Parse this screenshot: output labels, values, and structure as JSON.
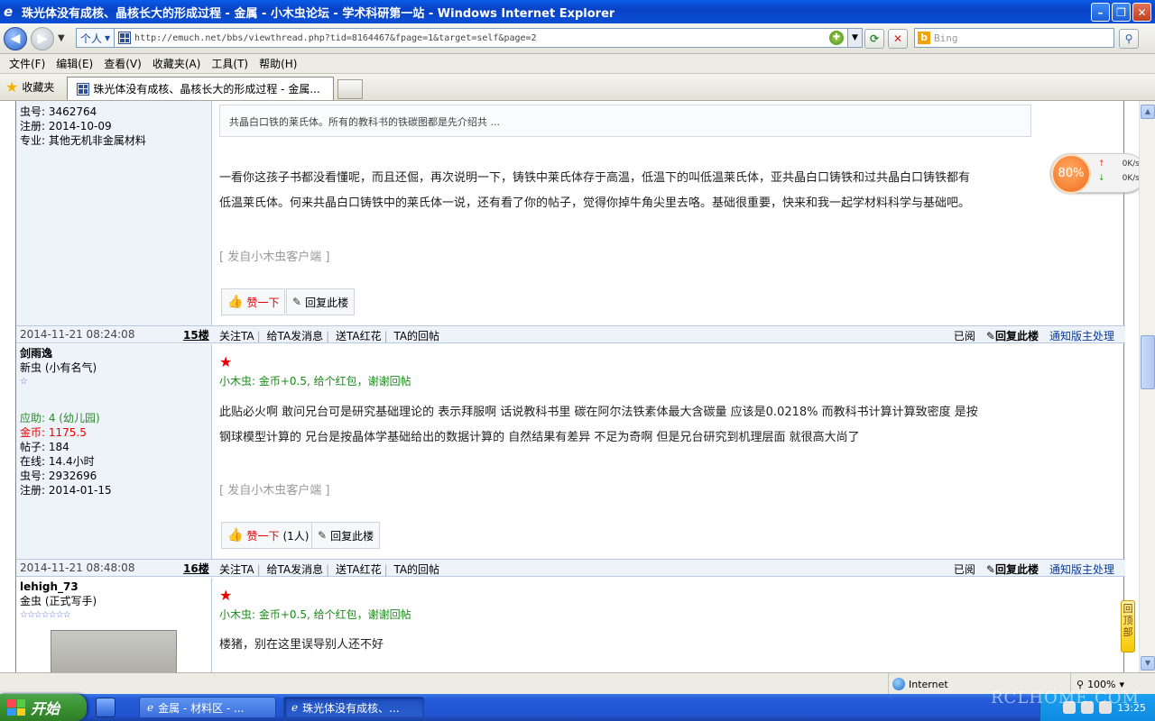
{
  "window": {
    "title": "珠光体没有成核、晶核长大的形成过程 - 金属 - 小木虫论坛 - 学术科研第一站 - Windows Internet Explorer",
    "min": "–",
    "max": "❐",
    "close": "✕"
  },
  "address": {
    "profile": "个人",
    "url": "http://emuch.net/bbs/viewthread.php?tid=8164467&fpage=1&target=self&page=2",
    "search_placeholder": "Bing"
  },
  "menu": [
    "文件(F)",
    "编辑(E)",
    "查看(V)",
    "收藏夹(A)",
    "工具(T)",
    "帮助(H)"
  ],
  "favorites": {
    "label": "收藏夹",
    "tab_title": "珠光体没有成核、晶核长大的形成过程 - 金属..."
  },
  "gauge": {
    "percent": "80%",
    "up_rate": "0K/s",
    "down_rate": "0K/s"
  },
  "post14": {
    "author": {
      "uid": "虫号: 3462764",
      "reg": "注册: 2014-10-09",
      "major": "专业: 其他无机非金属材料"
    },
    "quote": "共晶白口铁的莱氏体。所有的教科书的铁碳图都是先介绍共 ...",
    "text1": "一看你这孩子书都没看懂呢，而且还倔，再次说明一下，铸铁中莱氏体存于高温，低温下的叫低温莱氏体，亚共晶白口铸铁和过共晶白口铸铁都有",
    "text2": "低温莱氏体。何来共晶白口铸铁中的莱氏体一说，还有看了你的帖子，觉得你掉牛角尖里去咯。基础很重要，快来和我一起学材料科学与基础吧。",
    "from": "[ 发自小木虫客户端 ]",
    "like": "赞一下",
    "reply": "回复此楼"
  },
  "bar15": {
    "time": "2014-11-21 08:24:08",
    "floor": "15楼"
  },
  "post15": {
    "author": {
      "name": "剑雨逸",
      "rank": "新虫 (小有名气)",
      "stars": "☆",
      "help": "应助: 4 (幼儿园)",
      "coins": "金币: 1175.5",
      "posts": "帖子: 184",
      "online": "在线: 14.4小时",
      "uid": "虫号: 2932696",
      "reg": "注册: 2014-01-15"
    },
    "reward": "小木虫: 金币+0.5, 给个红包，谢谢回帖",
    "text1": "此贴必火啊 敢问兄台可是研究基础理论的 表示拜服啊 话说教科书里 碳在阿尔法铁素体最大含碳量 应该是0.0218% 而教科书计算计算致密度 是按",
    "text2": "钢球模型计算的 兄台是按晶体学基础给出的数据计算的 自然结果有差异 不足为奇啊 但是兄台研究到机理层面 就很高大尚了",
    "from": "[ 发自小木虫客户端 ]",
    "like": "赞一下",
    "like_count": "(1人)",
    "reply": "回复此楼"
  },
  "bar16": {
    "time": "2014-11-21 08:48:08",
    "floor": "16楼"
  },
  "postbar_actions": {
    "follow": "关注TA",
    "msg": "给TA发消息",
    "flower": "送TA红花",
    "posts": "TA的回帖",
    "read": "已阅",
    "reply": "回复此楼",
    "notify": "通知版主处理"
  },
  "post16": {
    "author": {
      "name": "lehigh_73",
      "rank": "金虫 (正式写手)",
      "stars": "☆☆☆☆☆☆☆"
    },
    "reward": "小木虫: 金币+0.5, 给个红包，谢谢回帖",
    "text1": "楼猪，别在这里误导别人还不好"
  },
  "totop": "回顶部",
  "status": {
    "zone": "Internet",
    "zoom": "100%"
  },
  "taskbar": {
    "start": "开始",
    "task1": "金属 - 材料区 - ...",
    "task2": "珠光体没有成核、...",
    "clock": "13:25"
  },
  "watermark": "RCLHOME.COM"
}
